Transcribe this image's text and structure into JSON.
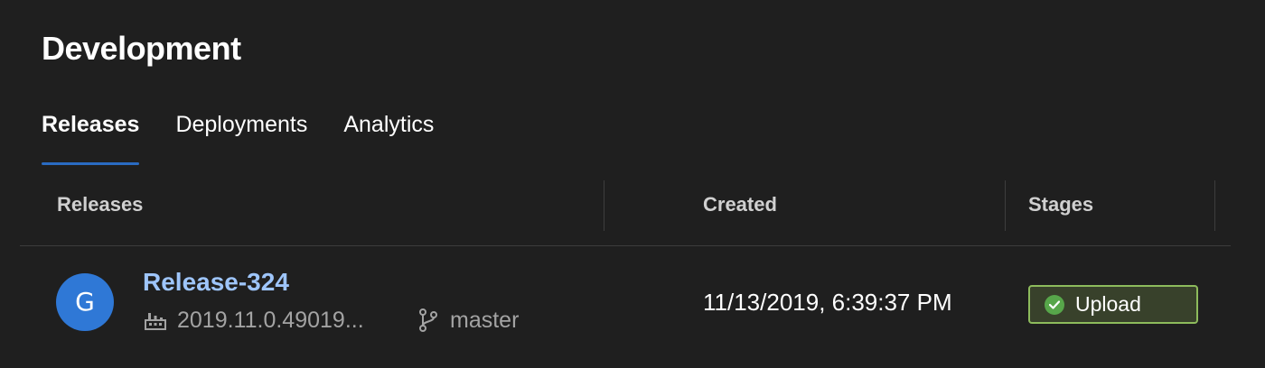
{
  "page": {
    "title": "Development"
  },
  "tabs": [
    {
      "label": "Releases",
      "active": true
    },
    {
      "label": "Deployments",
      "active": false
    },
    {
      "label": "Analytics",
      "active": false
    }
  ],
  "table": {
    "headers": {
      "releases": "Releases",
      "created": "Created",
      "stages": "Stages"
    },
    "rows": [
      {
        "avatar_initial": "G",
        "avatar_color": "#2f78d6",
        "release_name": "Release-324",
        "build_number": "2019.11.0.49019...",
        "build_icon": "build-pipeline-icon",
        "branch": "master",
        "branch_icon": "git-branch-icon",
        "created": "11/13/2019, 6:39:37 PM",
        "stage": {
          "label": "Upload",
          "status": "succeeded",
          "status_icon": "check-circle-icon"
        }
      }
    ]
  },
  "colors": {
    "accent": "#2a6bc2",
    "link": "#9ec5fa",
    "success": "#57a64a",
    "stage_border": "#8dbb5c"
  }
}
